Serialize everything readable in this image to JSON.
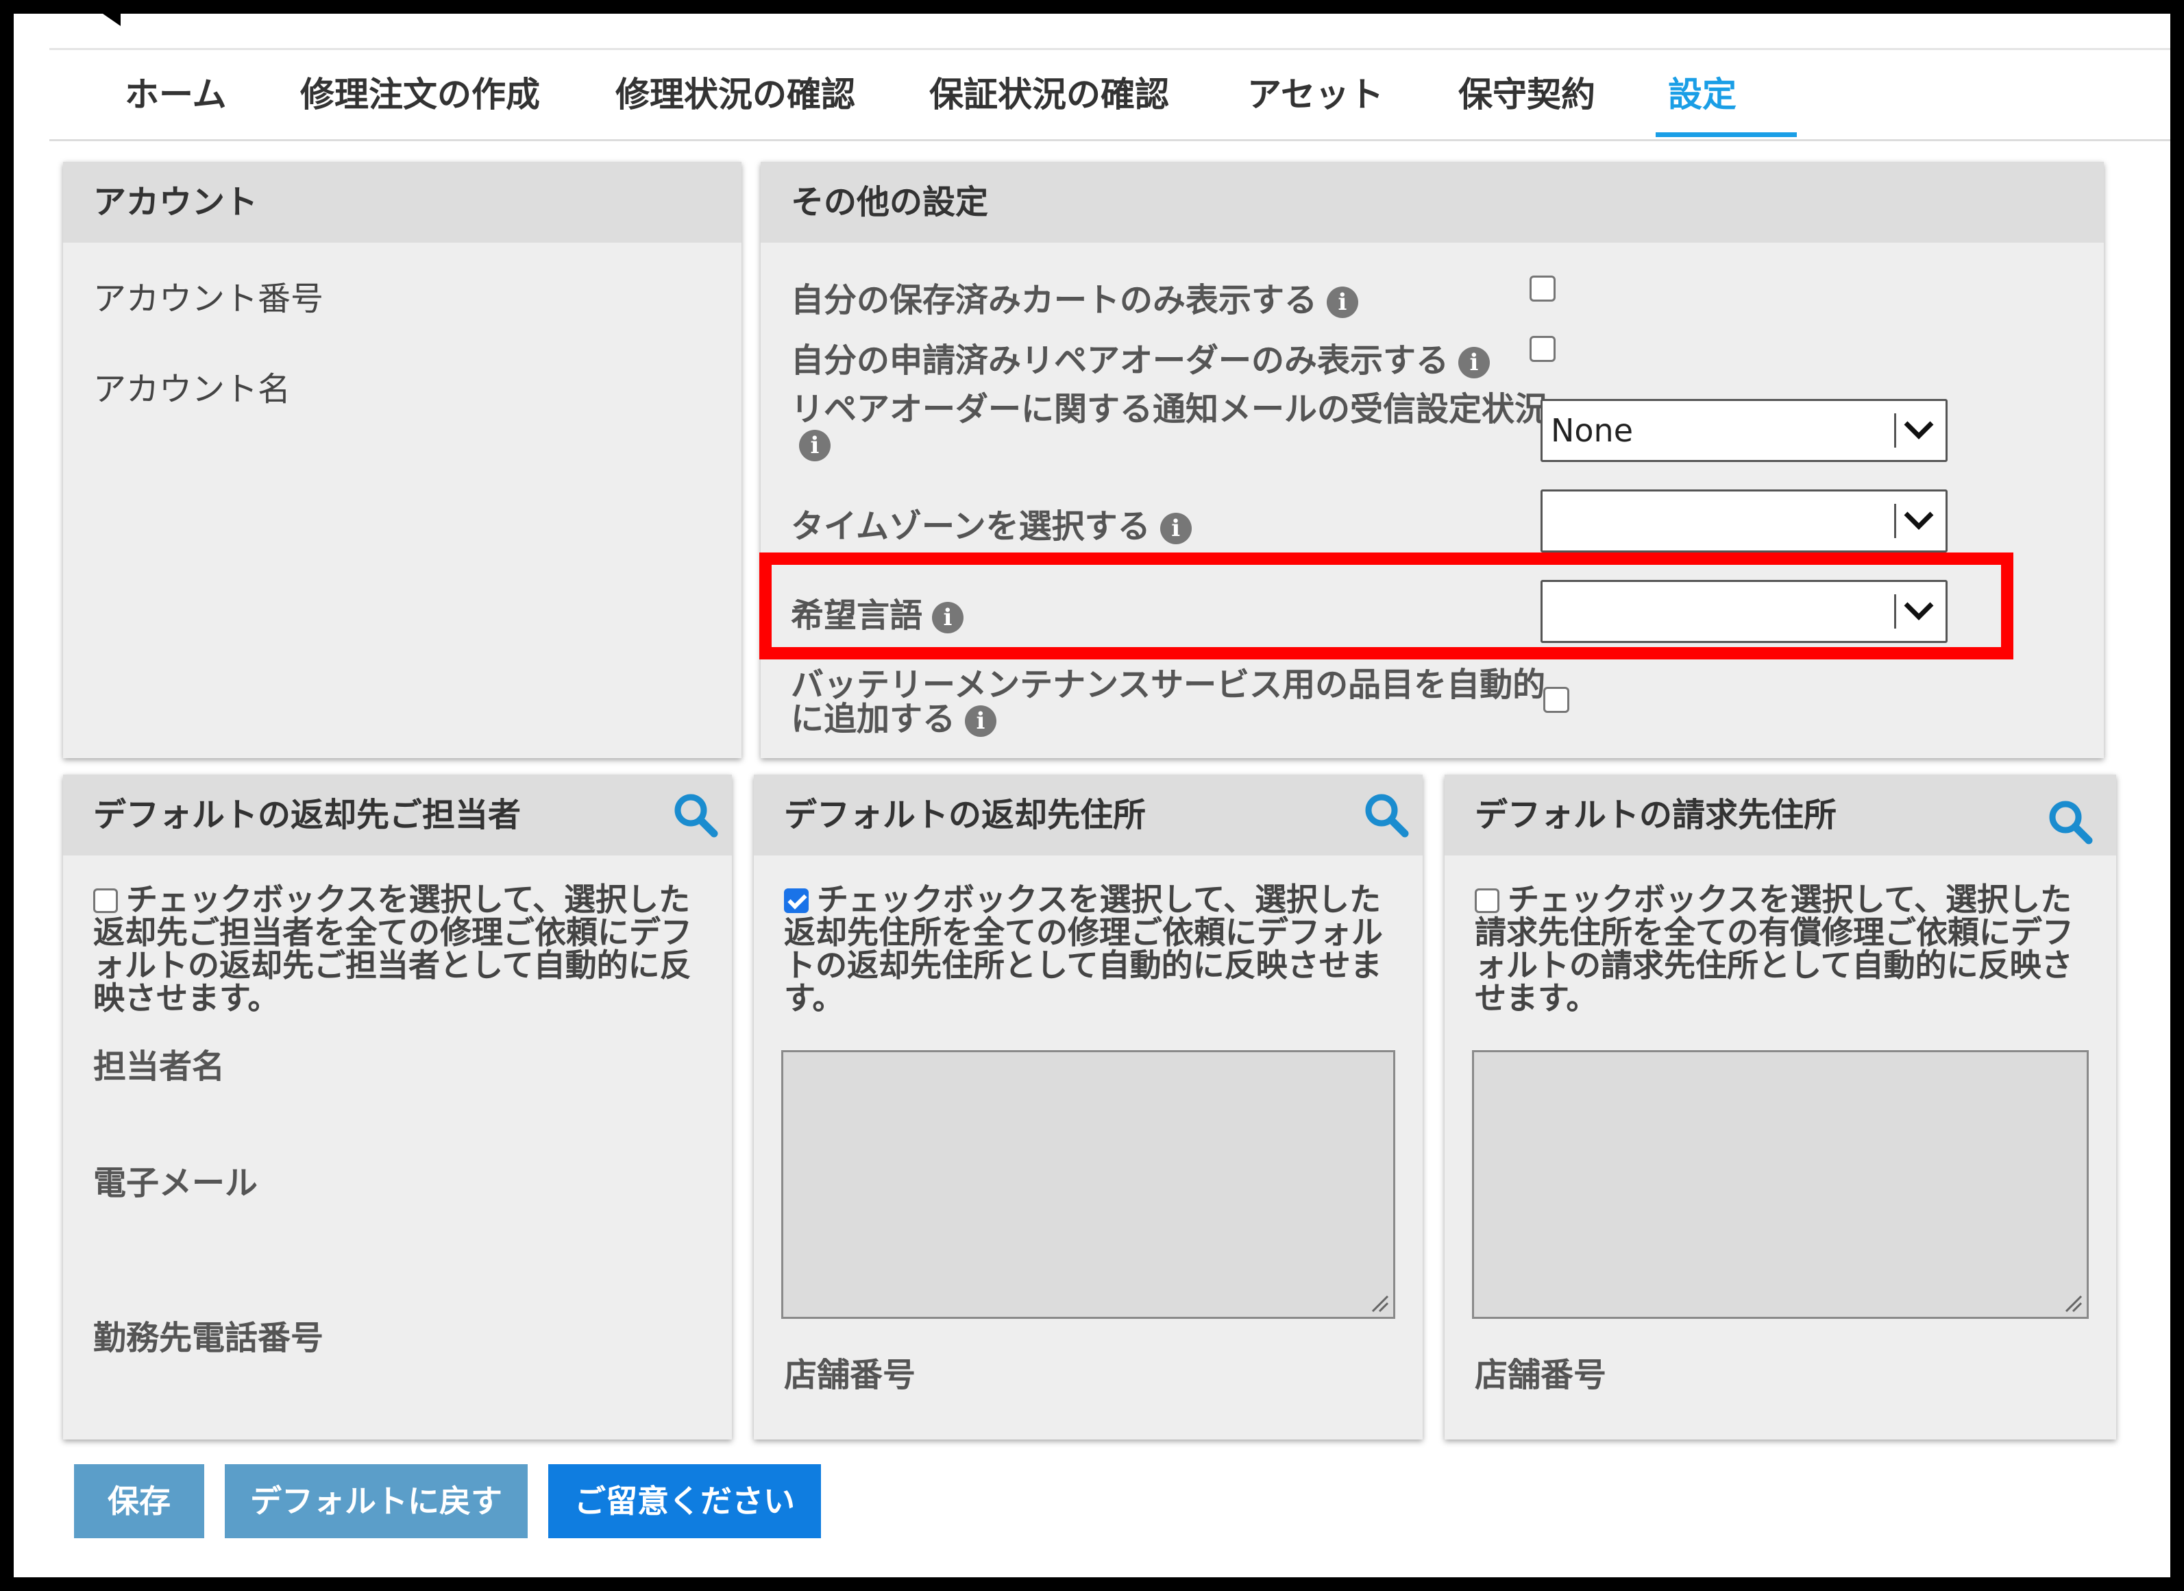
{
  "nav": {
    "tabs": [
      {
        "label": "ホーム"
      },
      {
        "label": "修理注文の作成"
      },
      {
        "label": "修理状況の確認"
      },
      {
        "label": "保証状況の確認"
      },
      {
        "label": "アセット"
      },
      {
        "label": "保守契約"
      },
      {
        "label": "設定",
        "active": true
      }
    ]
  },
  "account": {
    "title": "アカウント",
    "fields": [
      "アカウント番号",
      "アカウント名"
    ]
  },
  "other_settings": {
    "title": "その他の設定",
    "show_saved_carts_label": "自分の保存済みカートのみ表示する",
    "show_saved_carts_checked": false,
    "show_repair_orders_label": "自分の申請済みリペアオーダーのみ表示する",
    "show_repair_orders_checked": false,
    "notification_label": "リペアオーダーに関する通知メールの受信設定状況",
    "notification_value": "None",
    "timezone_label": "タイムゾーンを選択する",
    "timezone_value": "",
    "language_label": "希望言語",
    "language_value": "",
    "battery_label_line1": "バッテリーメンテナンスサービス用の品目を自動的",
    "battery_label_line2": "に追加する",
    "battery_checked": false,
    "info_glyph": "i"
  },
  "return_contact": {
    "title": "デフォルトの返却先ご担当者",
    "checkbox_checked": false,
    "description": "チェックボックスを選択して、選択した返却先ご担当者を全ての修理ご依頼にデフォルトの返却先ご担当者として自動的に反映させます。",
    "fields": [
      "担当者名",
      "電子メール",
      "勤務先電話番号"
    ]
  },
  "return_address": {
    "title": "デフォルトの返却先住所",
    "checkbox_checked": true,
    "description": "チェックボックスを選択して、選択した返却先住所を全ての修理ご依頼にデフォルトの返却先住所として自動的に反映させます。",
    "store_label": "店舗番号"
  },
  "billing_address": {
    "title": "デフォルトの請求先住所",
    "checkbox_checked": false,
    "description": "チェックボックスを選択して、選択した請求先住所を全ての有償修理ご依頼にデフォルトの請求先住所として自動的に反映させます。",
    "store_label": "店舗番号"
  },
  "buttons": {
    "save": "保存",
    "reset": "デフォルトに戻す",
    "notice": "ご留意ください"
  },
  "colors": {
    "accent": "#1a9ee6",
    "highlight": "#ff0000",
    "button_disabled": "#5b9ec9",
    "button_primary": "#0f7de0"
  }
}
